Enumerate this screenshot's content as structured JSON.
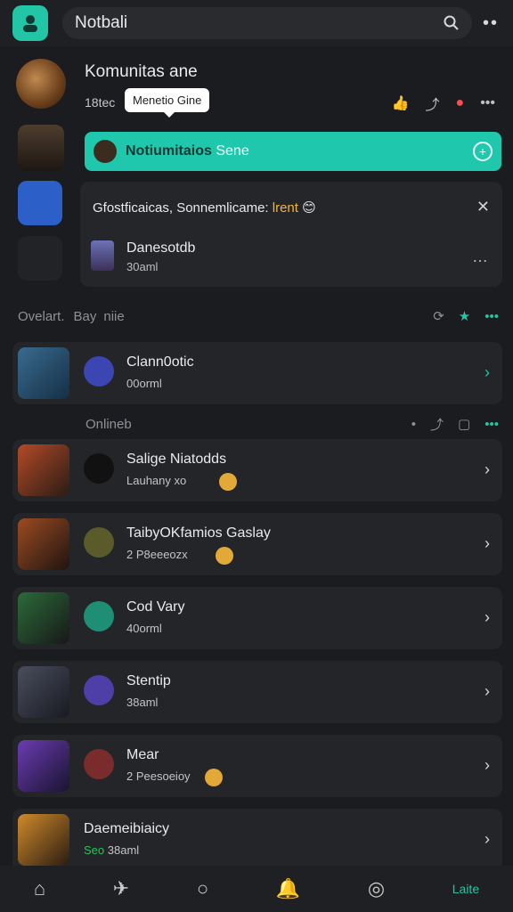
{
  "topbar": {
    "title": "Notbali",
    "icons": {
      "search": "search-icon",
      "more": "more-icon"
    }
  },
  "header": {
    "title": "Komunitas ane",
    "meta": "18tec",
    "tooltip": "Menetio Gine",
    "actions": [
      "thumb-icon",
      "share-icon",
      "user-alert-icon",
      "more-icon"
    ]
  },
  "banner": {
    "text": "Notiumitaios",
    "text_suffix": "Sene",
    "action_icon": "plus-circle-icon"
  },
  "notification": {
    "text": "Gfostficaicas, Sonnemlicame:",
    "tag": "lrent",
    "name": "Danesotdb",
    "time": "30aml"
  },
  "sections": {
    "first": {
      "label_left": "Ovelart.",
      "label_mid": "Bay",
      "label_right": "niie"
    },
    "online": "Onlineb"
  },
  "cards": [
    {
      "name": "Clann0otic",
      "sub": "00orml",
      "chev": "accent"
    },
    {
      "name": "Salige Niatodds",
      "sub": "Lauhany xo"
    },
    {
      "name": "TaibyOKfamios Gaslay",
      "sub": "2 P8eeeozx"
    },
    {
      "name": "Cod Vary",
      "sub": "40orml"
    },
    {
      "name": "Stentip",
      "sub": "38aml"
    },
    {
      "name": "Mear",
      "sub": "2 Peesoeioy"
    },
    {
      "name": "Daemeibiaicy",
      "sub_prefix": "Seo",
      "sub": "38aml"
    }
  ],
  "bottom_nav": [
    {
      "icon": "home-icon"
    },
    {
      "icon": "send-icon"
    },
    {
      "icon": "circle-icon"
    },
    {
      "icon": "bell-icon"
    },
    {
      "icon": "compass-icon"
    },
    {
      "label": "Laite"
    }
  ],
  "colors": {
    "accent": "#22c6a6",
    "background": "#1b1c1f",
    "card": "#242528"
  }
}
